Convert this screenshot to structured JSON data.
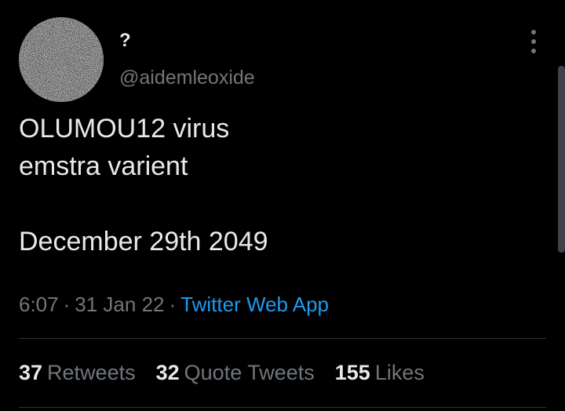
{
  "user": {
    "display_name": "?",
    "handle": "@aidemleoxide",
    "avatar_icon": "noise-pattern-avatar"
  },
  "tweet": {
    "text_lines": [
      "OLUMOU12 virus",
      "emstra varient"
    ],
    "date_line": "December 29th 2049",
    "time": "6:07",
    "date": "31 Jan 22",
    "separator": "·",
    "source": "Twitter Web App"
  },
  "stats": {
    "retweets_count": "37",
    "retweets_label": "Retweets",
    "quote_tweets_count": "32",
    "quote_tweets_label": "Quote Tweets",
    "likes_count": "155",
    "likes_label": "Likes"
  },
  "icons": {
    "more": "more-vertical-icon"
  },
  "colors": {
    "background": "#000000",
    "primary_text": "#e7e9ea",
    "secondary_text": "#71767b",
    "link": "#1d9bf0",
    "divider": "#2f3336"
  }
}
